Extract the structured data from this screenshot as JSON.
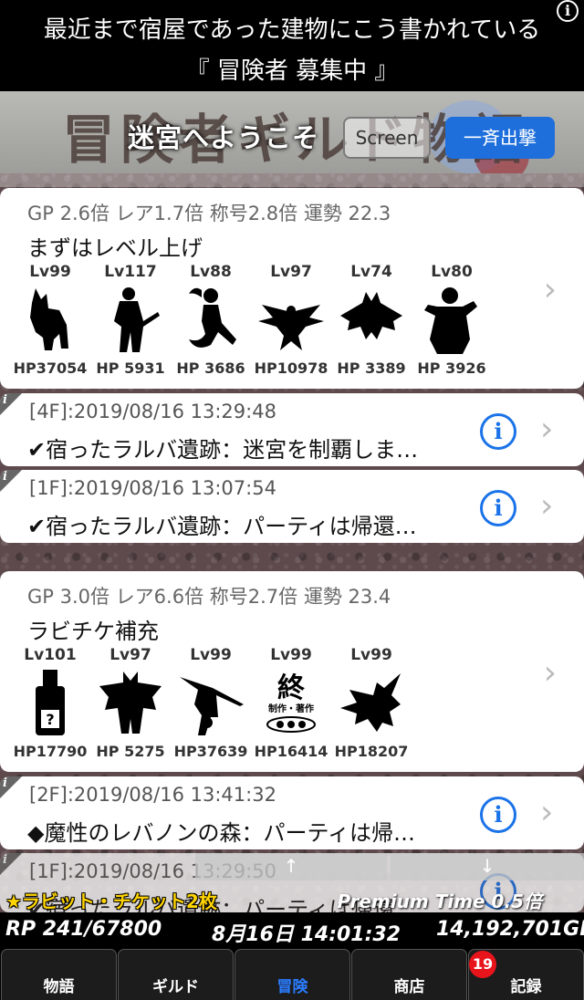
{
  "ad": {
    "line1": "最近まで宿屋であった建物にこう書かれている",
    "line2": "『 冒険者 募集中 』",
    "info_glyph": "i"
  },
  "header": {
    "logo_text": "冒険者ギルド物語",
    "title": "迷宮へようこそ",
    "screen_button": "Screen",
    "attack_button": "一斉出撃"
  },
  "parties": [
    {
      "stats": "GP 2.6倍   レア1.7倍   称号2.8倍   運勢 22.3",
      "name": "まずはレベル上げ",
      "monsters": [
        {
          "lv": "Lv99",
          "hp": "HP37054",
          "icon": "wolf"
        },
        {
          "lv": "Lv117",
          "hp": "HP 5931",
          "icon": "samurai"
        },
        {
          "lv": "Lv88",
          "hp": "HP 3686",
          "icon": "mermaid"
        },
        {
          "lv": "Lv97",
          "hp": "HP10978",
          "icon": "phoenix"
        },
        {
          "lv": "Lv74",
          "hp": "HP 3389",
          "icon": "bat"
        },
        {
          "lv": "Lv80",
          "hp": "HP 3926",
          "icon": "monk"
        }
      ]
    },
    {
      "stats": "GP 3.0倍   レア6.6倍   称号2.7倍   運勢 23.4",
      "name": "ラビチケ補充",
      "monsters": [
        {
          "lv": "Lv101",
          "hp": "HP17790",
          "icon": "bottle"
        },
        {
          "lv": "Lv97",
          "hp": "HP 5275",
          "icon": "demon"
        },
        {
          "lv": "Lv99",
          "hp": "HP37639",
          "icon": "witch"
        },
        {
          "lv": "Lv99",
          "hp": "HP16414",
          "icon": "end-card",
          "card_kanji": "終",
          "card_caption": "制作・著作"
        },
        {
          "lv": "Lv99",
          "hp": "HP18207",
          "icon": "dragon"
        }
      ]
    }
  ],
  "logs": [
    {
      "ts": "[4F]:2019/08/16 13:29:48",
      "msg": "✔宿ったラルバ遺跡：迷宮を制覇しま…"
    },
    {
      "ts": "[1F]:2019/08/16 13:07:54",
      "msg": "✔宿ったラルバ遺跡：パーティは帰還…"
    },
    {
      "ts": "[2F]:2019/08/16 13:41:32",
      "msg": "◆魔性のレバノンの森：パーティは帰…"
    },
    {
      "ts": "[1F]:2019/08/16 13:29:50",
      "msg": "✔宿ったラルバ遺跡：パーティは帰還…"
    }
  ],
  "overlay": {
    "ticket": "★ラビット・チケット2枚",
    "premium": "Premium Time 0.5倍",
    "scroll_up": "↑",
    "scroll_down": "↓"
  },
  "status": {
    "rp": "RP 241/67800",
    "datetime": "8月16日 14:01:32",
    "gp": "14,192,701GP"
  },
  "tabs": [
    {
      "label": "物語",
      "active": false
    },
    {
      "label": "ギルド",
      "active": false
    },
    {
      "label": "冒険",
      "active": true
    },
    {
      "label": "商店",
      "active": false
    },
    {
      "label": "記録",
      "active": false,
      "badge": "19"
    }
  ],
  "colors": {
    "accent": "#1a73e8",
    "active_tab": "#2b7cff",
    "badge": "#e8141c",
    "ticket": "#ffd400"
  }
}
